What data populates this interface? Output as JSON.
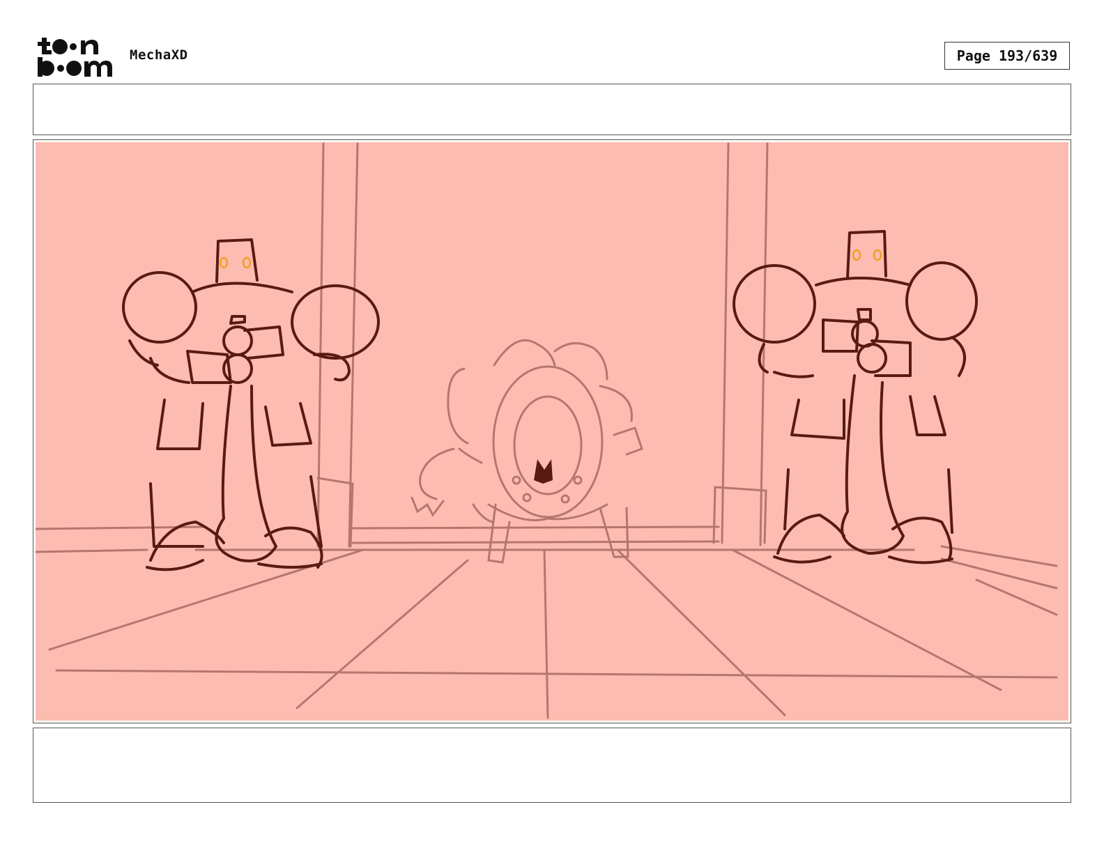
{
  "header": {
    "logo": {
      "icon": "toon-boom-logo",
      "text": "toon boom"
    },
    "project_title": "MechaXD",
    "page_label": "Page 193/639"
  },
  "dialogue": {
    "text": ""
  },
  "notes": {
    "text": ""
  },
  "colors": {
    "panel_fill": "#fdbcb1",
    "dark_line": "#5a1a14",
    "light_line": "#b5766e",
    "eye_glow": "#f0a020"
  }
}
